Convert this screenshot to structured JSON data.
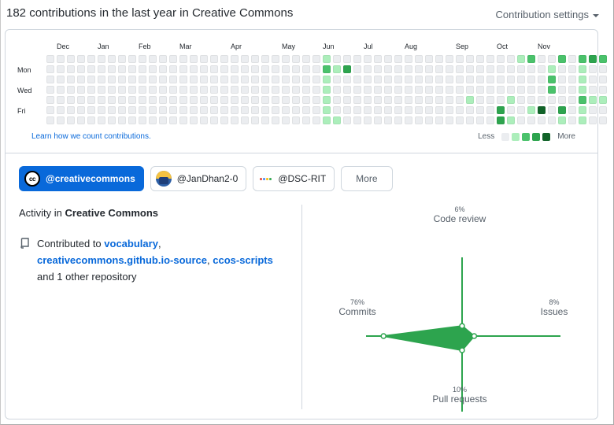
{
  "header": {
    "title": "182 contributions in the last year in Creative Commons",
    "settings_label": "Contribution settings"
  },
  "calendar": {
    "months": [
      "Dec",
      "Jan",
      "Feb",
      "Mar",
      "Apr",
      "May",
      "Jun",
      "Jul",
      "Aug",
      "Sep",
      "Oct",
      "Nov"
    ],
    "weekday_labels": [
      "Mon",
      "Wed",
      "Fri"
    ],
    "learn_link": "Learn how we count contributions.",
    "legend_less": "Less",
    "legend_more": "More",
    "levels": [
      "#ebedf0",
      "#aceebb",
      "#4ac26b",
      "#2da44e",
      "#116329"
    ],
    "weeks": [
      [
        0,
        0,
        0,
        0,
        0,
        0,
        0
      ],
      [
        0,
        0,
        0,
        0,
        0,
        0,
        0
      ],
      [
        0,
        0,
        0,
        0,
        0,
        0,
        0
      ],
      [
        0,
        0,
        0,
        0,
        0,
        0,
        0
      ],
      [
        0,
        0,
        0,
        0,
        0,
        0,
        0
      ],
      [
        0,
        0,
        0,
        0,
        0,
        0,
        0
      ],
      [
        0,
        0,
        0,
        0,
        0,
        0,
        0
      ],
      [
        0,
        0,
        0,
        0,
        0,
        0,
        0
      ],
      [
        0,
        0,
        0,
        0,
        0,
        0,
        0
      ],
      [
        0,
        0,
        0,
        0,
        0,
        0,
        0
      ],
      [
        0,
        0,
        0,
        0,
        0,
        0,
        0
      ],
      [
        0,
        0,
        0,
        0,
        0,
        0,
        0
      ],
      [
        0,
        0,
        0,
        0,
        0,
        0,
        0
      ],
      [
        0,
        0,
        0,
        0,
        0,
        0,
        0
      ],
      [
        0,
        0,
        0,
        0,
        0,
        0,
        0
      ],
      [
        0,
        0,
        0,
        0,
        0,
        0,
        0
      ],
      [
        0,
        0,
        0,
        0,
        0,
        0,
        0
      ],
      [
        0,
        0,
        0,
        0,
        0,
        0,
        0
      ],
      [
        0,
        0,
        0,
        0,
        0,
        0,
        0
      ],
      [
        0,
        0,
        0,
        0,
        0,
        0,
        0
      ],
      [
        0,
        0,
        0,
        0,
        0,
        0,
        0
      ],
      [
        0,
        0,
        0,
        0,
        0,
        0,
        0
      ],
      [
        0,
        0,
        0,
        0,
        0,
        0,
        0
      ],
      [
        0,
        0,
        0,
        0,
        0,
        0,
        0
      ],
      [
        0,
        0,
        0,
        0,
        0,
        0,
        0
      ],
      [
        0,
        0,
        0,
        0,
        0,
        0,
        0
      ],
      [
        0,
        0,
        0,
        0,
        0,
        0,
        0
      ],
      [
        1,
        2,
        1,
        1,
        1,
        1,
        1
      ],
      [
        0,
        1,
        0,
        0,
        0,
        0,
        1
      ],
      [
        0,
        3,
        0,
        0,
        0,
        0,
        0
      ],
      [
        0,
        0,
        0,
        0,
        0,
        0,
        0
      ],
      [
        0,
        0,
        0,
        0,
        0,
        0,
        0
      ],
      [
        0,
        0,
        0,
        0,
        0,
        0,
        0
      ],
      [
        0,
        0,
        0,
        0,
        0,
        0,
        0
      ],
      [
        0,
        0,
        0,
        0,
        0,
        0,
        0
      ],
      [
        0,
        0,
        0,
        0,
        0,
        0,
        0
      ],
      [
        0,
        0,
        0,
        0,
        0,
        0,
        0
      ],
      [
        0,
        0,
        0,
        0,
        0,
        0,
        0
      ],
      [
        0,
        0,
        0,
        0,
        0,
        0,
        0
      ],
      [
        0,
        0,
        0,
        0,
        0,
        0,
        0
      ],
      [
        0,
        0,
        0,
        0,
        0,
        0,
        0
      ],
      [
        0,
        0,
        0,
        0,
        1,
        0,
        0
      ],
      [
        0,
        0,
        0,
        0,
        0,
        0,
        0
      ],
      [
        0,
        0,
        0,
        0,
        0,
        0,
        0
      ],
      [
        0,
        0,
        0,
        0,
        0,
        3,
        3
      ],
      [
        0,
        0,
        0,
        0,
        1,
        0,
        1
      ],
      [
        1,
        0,
        0,
        0,
        0,
        0,
        0
      ],
      [
        2,
        0,
        0,
        0,
        0,
        1,
        0
      ],
      [
        0,
        0,
        0,
        0,
        0,
        4,
        0
      ],
      [
        0,
        1,
        2,
        2,
        0,
        0,
        0
      ],
      [
        2,
        0,
        0,
        0,
        0,
        3,
        1
      ],
      [
        0,
        0,
        0,
        0,
        0,
        0,
        0
      ],
      [
        2,
        1,
        1,
        1,
        2,
        1,
        1
      ],
      [
        3,
        0,
        0,
        0,
        1,
        0,
        0
      ],
      [
        2,
        0,
        0,
        0,
        1,
        0,
        0
      ]
    ]
  },
  "orgs": [
    {
      "name": "@creativecommons",
      "selected": true,
      "logo": "cc-icon"
    },
    {
      "name": "@JanDhan2-0",
      "selected": false,
      "logo": "jandhan-icon"
    },
    {
      "name": "@DSC-RIT",
      "selected": false,
      "logo": "dsc-icon"
    },
    {
      "name": "More",
      "selected": false
    }
  ],
  "activity": {
    "prefix": "Activity in ",
    "org": "Creative Commons",
    "contrib_prefix": "Contributed to ",
    "repos": [
      "vocabulary",
      "creativecommons.github.io-source",
      "ccos-scripts"
    ],
    "suffix": "and 1 other repository"
  },
  "radar": {
    "axes": [
      {
        "name": "Code review",
        "percent": 6,
        "pct_label": "6%"
      },
      {
        "name": "Issues",
        "percent": 8,
        "pct_label": "8%"
      },
      {
        "name": "Pull requests",
        "percent": 10,
        "pct_label": "10%"
      },
      {
        "name": "Commits",
        "percent": 76,
        "pct_label": "76%"
      }
    ],
    "color": "#2da44e"
  }
}
